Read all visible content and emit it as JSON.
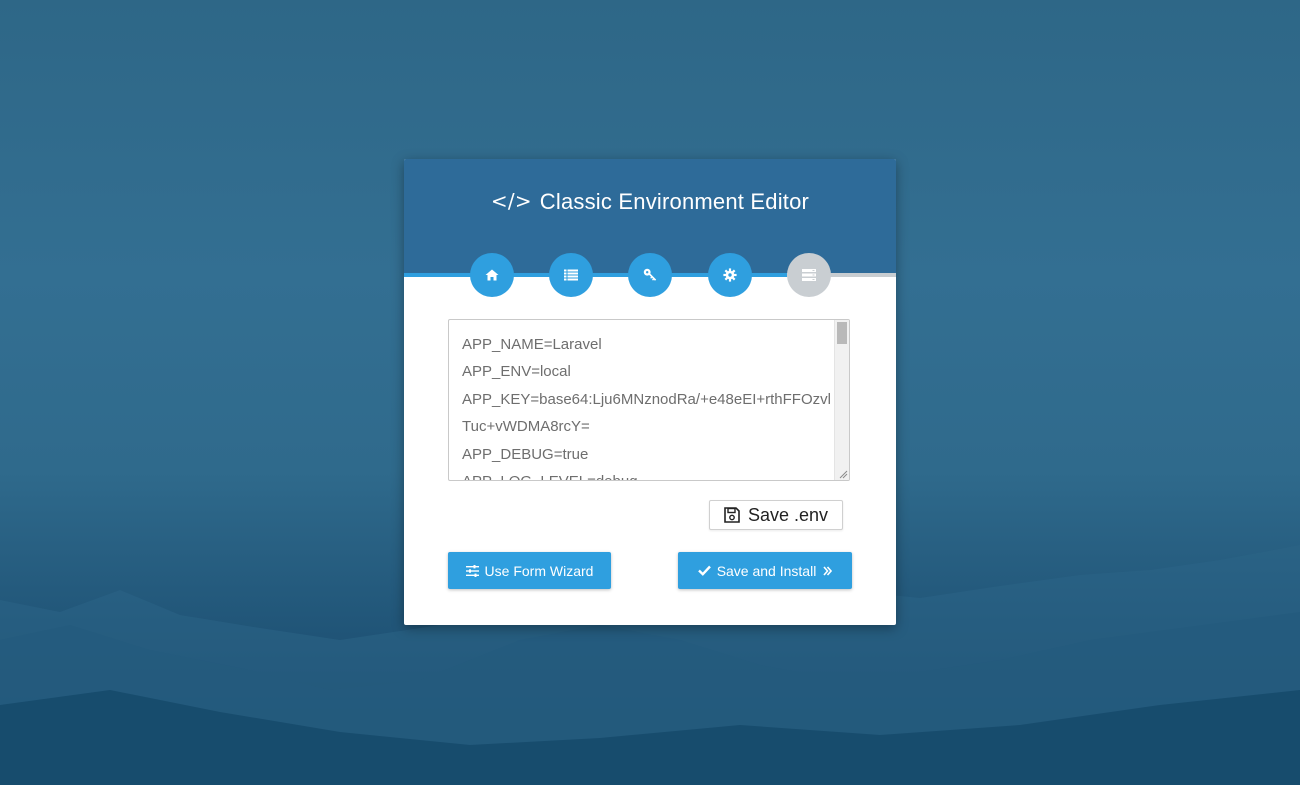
{
  "window": {
    "title": "Classic Environment Editor",
    "title_icon": "code-icon"
  },
  "steps": [
    {
      "icon": "home-icon",
      "state": "done"
    },
    {
      "icon": "list-icon",
      "state": "done"
    },
    {
      "icon": "key-icon",
      "state": "done"
    },
    {
      "icon": "gear-icon",
      "state": "done"
    },
    {
      "icon": "server-icon",
      "state": "pending"
    }
  ],
  "editor": {
    "content": "APP_NAME=Laravel\nAPP_ENV=local\nAPP_KEY=base64:Lju6MNznodRa/+e48eEI+rthFFOzvlTuc+vWDMA8rcY=\nAPP_DEBUG=true\nAPP_LOG_LEVEL=debug"
  },
  "buttons": {
    "save_env": "Save .env",
    "use_form_wizard": "Use Form Wizard",
    "save_and_install": "Save and Install"
  },
  "colors": {
    "header": "#2e6b99",
    "accent": "#2f9fdf",
    "inactive_step": "#c9ced2",
    "background": "#2f6a8c"
  }
}
